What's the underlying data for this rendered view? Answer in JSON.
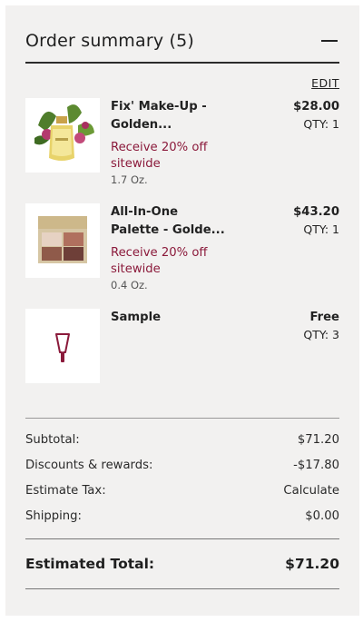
{
  "summary": {
    "title": "Order summary (5)",
    "edit_label": "EDIT"
  },
  "items": [
    {
      "name_line1": "Fix' Make-Up -",
      "name_line2": "Golden...",
      "promo_line1": "Receive 20% off",
      "promo_line2": "sitewide",
      "size": "1.7 Oz.",
      "price": "$28.00",
      "qty": "QTY: 1",
      "image": "perfume-bottle-with-flowers"
    },
    {
      "name_line1": "All-In-One",
      "name_line2": "Palette - Golde...",
      "promo_line1": "Receive 20% off",
      "promo_line2": "sitewide",
      "size": "0.4 Oz.",
      "price": "$43.20",
      "qty": "QTY: 1",
      "image": "eyeshadow-palette"
    },
    {
      "name_line1": "Sample",
      "price": "Free",
      "qty": "QTY: 3",
      "image": "sample-tube-icon"
    }
  ],
  "totals": {
    "subtotal_label": "Subtotal:",
    "subtotal_value": "$71.20",
    "discounts_label": "Discounts & rewards:",
    "discounts_value": "-$17.80",
    "tax_label": "Estimate Tax:",
    "tax_value": "Calculate",
    "shipping_label": "Shipping:",
    "shipping_value": "$0.00",
    "total_label": "Estimated Total:",
    "total_value": "$71.20"
  },
  "colors": {
    "promo": "#8b1a3b",
    "panel_bg": "#f2f1f0"
  }
}
